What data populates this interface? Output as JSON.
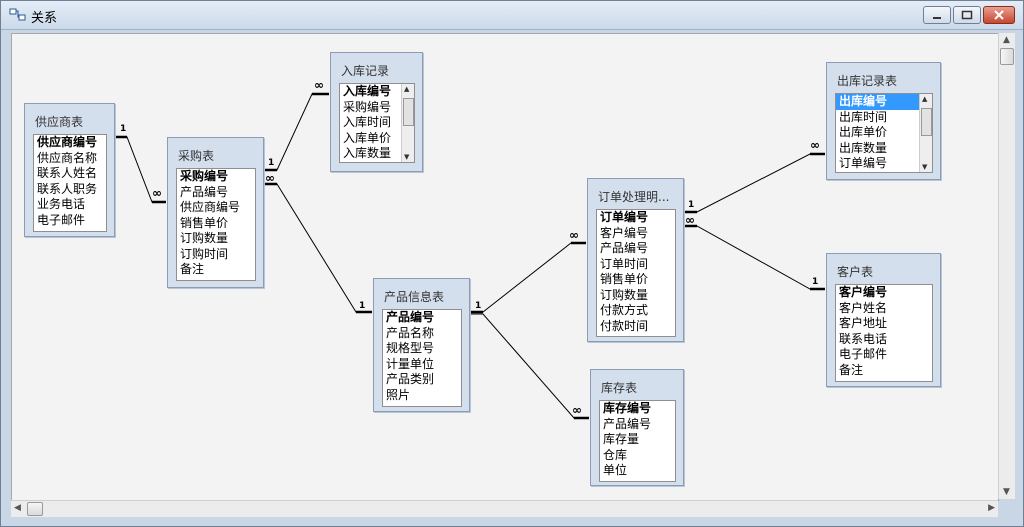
{
  "window": {
    "title": "关系"
  },
  "tables": {
    "supplier": {
      "title": "供应商表",
      "fields": [
        "供应商编号",
        "供应商名称",
        "联系人姓名",
        "联系人职务",
        "业务电话",
        "电子邮件"
      ]
    },
    "purchase": {
      "title": "采购表",
      "fields": [
        "采购编号",
        "产品编号",
        "供应商编号",
        "销售单价",
        "订购数量",
        "订购时间",
        "备注"
      ]
    },
    "instock": {
      "title": "入库记录",
      "fields": [
        "入库编号",
        "采购编号",
        "入库时间",
        "入库单价",
        "入库数量"
      ]
    },
    "product": {
      "title": "产品信息表",
      "fields": [
        "产品编号",
        "产品名称",
        "规格型号",
        "计量单位",
        "产品类别",
        "照片"
      ]
    },
    "order": {
      "title": "订单处理明...",
      "fields": [
        "订单编号",
        "客户编号",
        "产品编号",
        "订单时间",
        "销售单价",
        "订购数量",
        "付款方式",
        "付款时间"
      ]
    },
    "stock": {
      "title": "库存表",
      "fields": [
        "库存编号",
        "产品编号",
        "库存量",
        "仓库",
        "单位"
      ]
    },
    "outstock": {
      "title": "出库记录表",
      "fields": [
        "出库编号",
        "出库时间",
        "出库单价",
        "出库数量",
        "订单编号"
      ]
    },
    "customer": {
      "title": "客户表",
      "fields": [
        "客户编号",
        "客户姓名",
        "客户地址",
        "联系电话",
        "电子邮件",
        "备注"
      ]
    }
  },
  "relationship_labels": {
    "one": "1",
    "many": "∞"
  },
  "icons": [
    "relationships-icon",
    "minimize-icon",
    "maximize-icon",
    "close-icon",
    "scroll-up-icon",
    "scroll-down-icon",
    "scroll-left-icon",
    "scroll-right-icon"
  ]
}
